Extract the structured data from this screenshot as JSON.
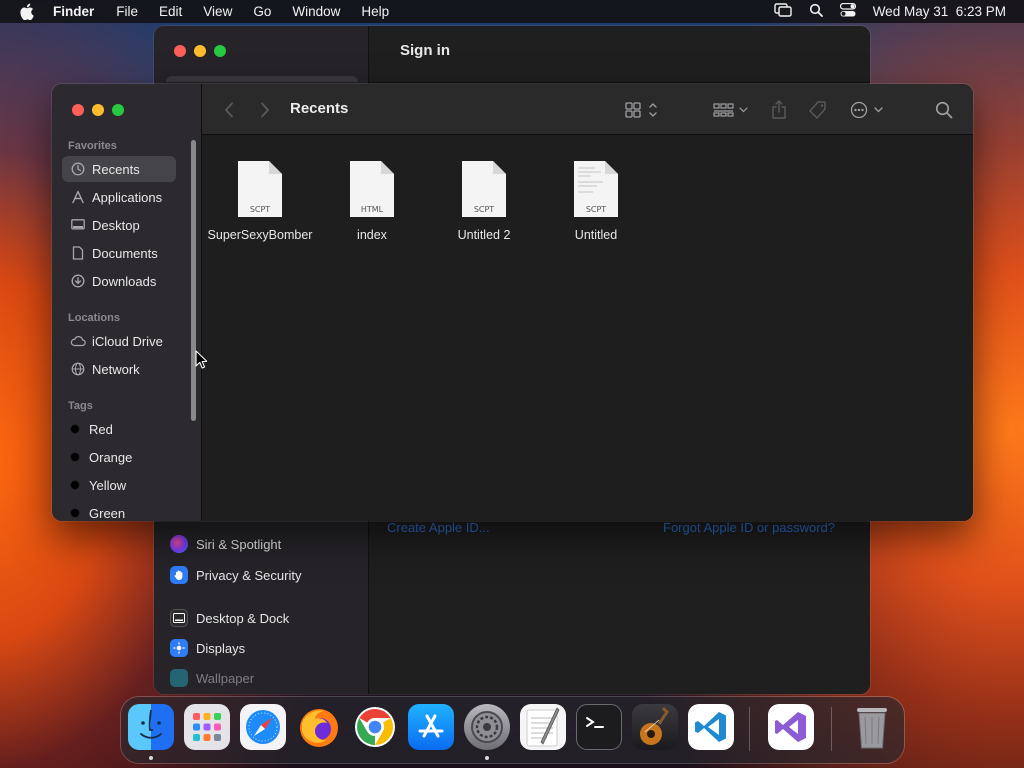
{
  "menubar": {
    "app": "Finder",
    "items": [
      "File",
      "Edit",
      "View",
      "Go",
      "Window",
      "Help"
    ],
    "datetime": "Wed May 31  6:23 PM"
  },
  "settings_window": {
    "title": "Sign in",
    "sidebar_items": [
      {
        "label": "Siri & Spotlight",
        "icon": "siri-icon"
      },
      {
        "label": "Privacy & Security",
        "icon": "hand-icon"
      },
      {
        "label": "Desktop & Dock",
        "icon": "dock-icon"
      },
      {
        "label": "Displays",
        "icon": "displays-icon"
      },
      {
        "label": "Wallpaper",
        "icon": "wallpaper-icon"
      }
    ],
    "links": {
      "create": "Create Apple ID...",
      "forgot": "Forgot Apple ID or password?"
    }
  },
  "finder": {
    "title": "Recents",
    "sidebar": {
      "favorites_header": "Favorites",
      "favorites": [
        {
          "label": "Recents",
          "icon": "clock-icon"
        },
        {
          "label": "Applications",
          "icon": "applications-icon"
        },
        {
          "label": "Desktop",
          "icon": "desktop-icon"
        },
        {
          "label": "Documents",
          "icon": "document-icon"
        },
        {
          "label": "Downloads",
          "icon": "download-icon"
        }
      ],
      "locations_header": "Locations",
      "locations": [
        {
          "label": "iCloud Drive",
          "icon": "cloud-icon"
        },
        {
          "label": "Network",
          "icon": "globe-icon"
        }
      ],
      "tags_header": "Tags",
      "tags": [
        "Red",
        "Orange",
        "Yellow",
        "Green"
      ]
    },
    "files": [
      {
        "name": "SuperSexyBomber",
        "kind": "SCPT"
      },
      {
        "name": "index",
        "kind": "HTML"
      },
      {
        "name": "Untitled 2",
        "kind": "SCPT"
      },
      {
        "name": "Untitled",
        "kind": "SCPT"
      }
    ]
  },
  "dock": {
    "apps": [
      "Finder",
      "Launchpad",
      "Safari",
      "Firefox",
      "Chrome",
      "App Store",
      "System Settings",
      "TextEdit",
      "Terminal",
      "GarageBand",
      "Visual Studio Code",
      "Visual Studio",
      "Trash"
    ]
  }
}
